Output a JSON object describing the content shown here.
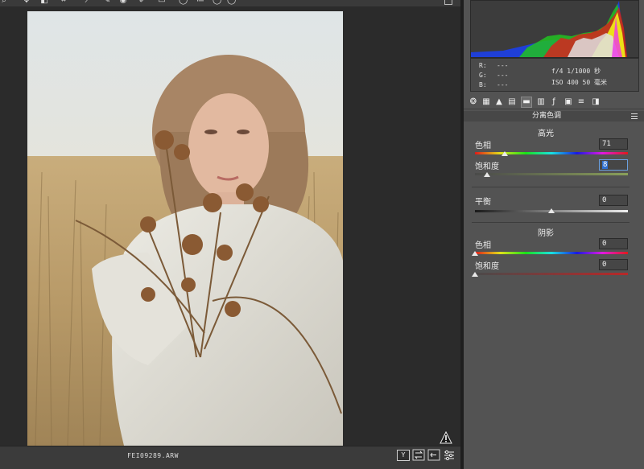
{
  "app": {
    "filename": "FEI09289.ARW"
  },
  "toolbar": {
    "tools": [
      {
        "name": "zoom-tool",
        "glyph": "⌕"
      },
      {
        "name": "hand-tool",
        "glyph": "✥"
      },
      {
        "name": "white-balance-tool",
        "glyph": "◧"
      },
      {
        "name": "crop-tool",
        "glyph": "⌗"
      },
      {
        "name": "straighten-tool",
        "glyph": "⟋"
      },
      {
        "name": "spot-removal-tool",
        "glyph": "✎"
      },
      {
        "name": "red-eye-tool",
        "glyph": "◉"
      },
      {
        "name": "brush-tool",
        "glyph": "✐"
      },
      {
        "name": "graduated-filter-tool",
        "glyph": "▭"
      },
      {
        "name": "radial-filter-tool",
        "glyph": "◯"
      },
      {
        "name": "preferences-tool",
        "glyph": "≔"
      },
      {
        "name": "rotate-left-tool",
        "glyph": "◯"
      },
      {
        "name": "rotate-right-tool",
        "glyph": "◯"
      }
    ]
  },
  "histogram": {
    "rgb": [
      {
        "label": "R:",
        "value": "---"
      },
      {
        "label": "G:",
        "value": "---"
      },
      {
        "label": "B:",
        "value": "---"
      }
    ],
    "aperture_shutter": "f/4  1/1000 秒",
    "iso_focal": "ISO 400  50 毫米"
  },
  "panel": {
    "section_title": "分离色调",
    "highlights": {
      "title": "高光",
      "hue_label": "色相",
      "hue_value": "71",
      "hue_pct": 0.197,
      "sat_label": "饱和度",
      "sat_value": "8",
      "sat_pct": 0.08
    },
    "balance": {
      "label": "平衡",
      "value": "0",
      "pct": 0.5
    },
    "shadows": {
      "title": "阴影",
      "hue_label": "色相",
      "hue_value": "0",
      "hue_pct": 0.0,
      "sat_label": "饱和度",
      "sat_value": "0",
      "sat_pct": 0.0
    }
  },
  "statusbar": {
    "compare_label": "Y"
  },
  "colors": {
    "panel_bg": "#535353",
    "canvas_bg": "#2b2b2b",
    "accent": "#2f6fd0"
  }
}
